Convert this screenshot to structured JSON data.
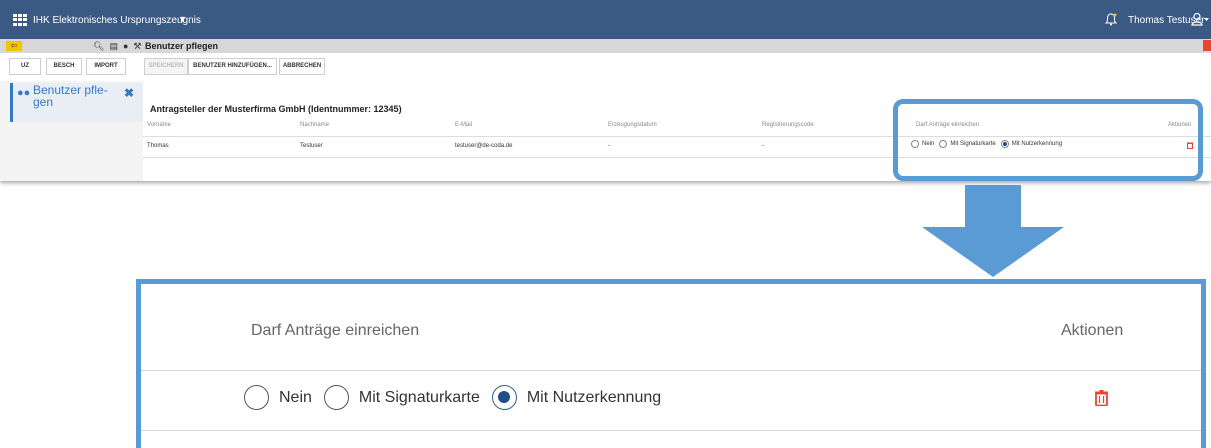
{
  "app": {
    "title": "IHK Elektronisches Ursprungszeugnis",
    "title_caret": "▼",
    "user_name": "Thomas Testuser"
  },
  "toolbar": {
    "back_symbol": "⇦",
    "page_title": "Benutzer pflegen",
    "icons": [
      "search-icon",
      "chart-icon",
      "users-icon",
      "wrench-icon"
    ]
  },
  "module_buttons": {
    "uz": "UZ",
    "besch": "BESCH",
    "import": "IMPORT"
  },
  "action_buttons": {
    "save": "SPEICHERN",
    "add_user": "BENUTZER HINZUFÜGEN...",
    "cancel": "ABBRECHEN"
  },
  "sidebar": {
    "item_label": "Benutzer pfle-gen",
    "close_symbol": "✖"
  },
  "main": {
    "section_title": "Antragsteller der Musterfirma GmbH (Identnummer: 12345)",
    "columns": {
      "vorname": "Vorname",
      "nachname": "Nachname",
      "email": "E-Mail",
      "erzeugungsdatum": "Erzeugungsdatum",
      "registrierungscode": "Registrierungscode",
      "darf": "Darf Anträge einreichen",
      "aktionen": "Aktionen"
    },
    "row": {
      "vorname": "Thomas",
      "nachname": "Testuser",
      "email": "testuser@de-coda.de",
      "erzeugungsdatum": "-",
      "registrierungscode": "-",
      "options": [
        "Nein",
        "Mit Signaturkarte",
        "Mit Nutzerkennung"
      ],
      "selected_option": "Mit Nutzerkennung"
    }
  },
  "zoom": {
    "header_left": "Darf Anträge einreichen",
    "header_right": "Aktionen",
    "option_nein": "Nein",
    "option_signaturkarte": "Mit Signaturkarte",
    "option_nutzerkennung": "Mit Nutzerkennung"
  },
  "colors": {
    "topbar": "#3b5a83",
    "highlight": "#5b9bd5",
    "accent_blue": "#3578c4",
    "back_button": "#f2c500",
    "trash_red": "#e8452c"
  }
}
